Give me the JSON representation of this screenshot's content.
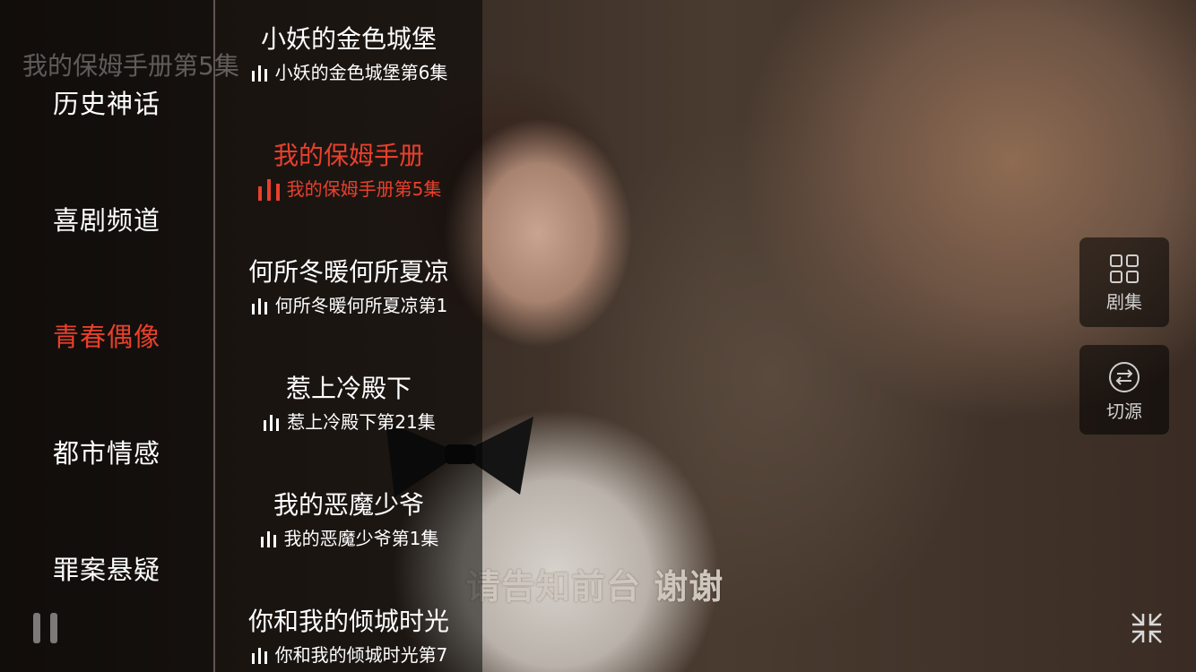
{
  "video": {
    "title": "我的保姆手册第5集",
    "subtitle": "请告知前台 谢谢"
  },
  "categories": [
    {
      "label": "历史神话",
      "active": false
    },
    {
      "label": "喜剧频道",
      "active": false
    },
    {
      "label": "青春偶像",
      "active": true
    },
    {
      "label": "都市情感",
      "active": false
    },
    {
      "label": "罪案悬疑",
      "active": false
    }
  ],
  "channels": [
    {
      "name": "小妖的金色城堡",
      "episode": "小妖的金色城堡第6集",
      "active": false
    },
    {
      "name": "我的保姆手册",
      "episode": "我的保姆手册第5集",
      "active": true
    },
    {
      "name": "何所冬暖何所夏凉",
      "episode": "何所冬暖何所夏凉第1",
      "active": false
    },
    {
      "name": "惹上冷殿下",
      "episode": "惹上冷殿下第21集",
      "active": false
    },
    {
      "name": "我的恶魔少爷",
      "episode": "我的恶魔少爷第1集",
      "active": false
    },
    {
      "name": "你和我的倾城时光",
      "episode": "你和我的倾城时光第7",
      "active": false
    }
  ],
  "side_buttons": {
    "episodes_label": "剧集",
    "switch_source_label": "切源"
  },
  "icons": {
    "pause": "pause-icon",
    "shrink": "exit-fullscreen-icon",
    "episodes": "grid-icon",
    "switch": "swap-arrows-icon",
    "playing": "equalizer-bars-icon"
  },
  "colors": {
    "accent": "#e8402c",
    "text": "#ffffff"
  }
}
